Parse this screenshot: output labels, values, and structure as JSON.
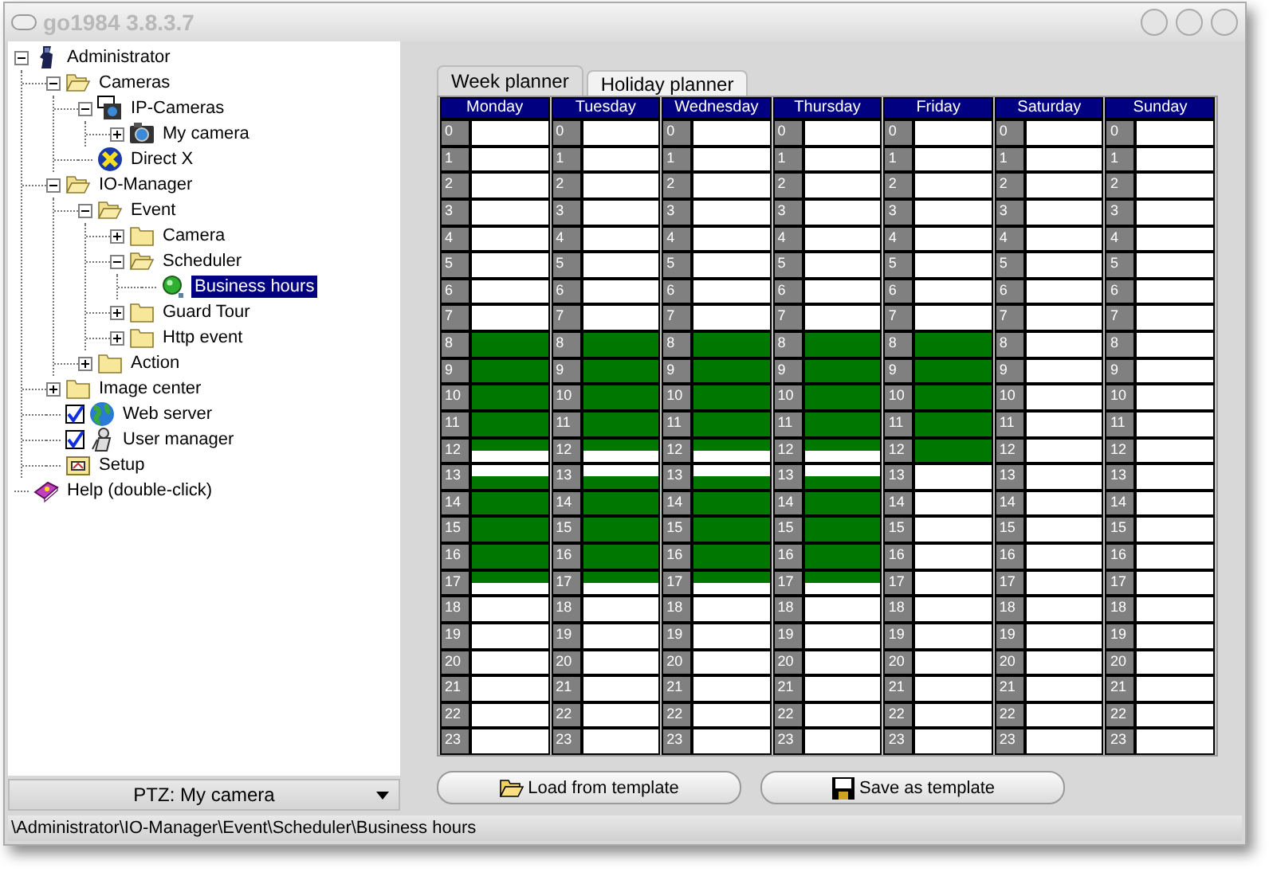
{
  "window": {
    "title": "go1984 3.8.3.7"
  },
  "tree": [
    {
      "label": "Administrator",
      "kind": "user",
      "expanded": true,
      "selected": false,
      "children": [
        {
          "label": "Cameras",
          "kind": "folder",
          "expanded": true,
          "selected": false,
          "children": [
            {
              "label": "IP-Cameras",
              "kind": "camera-group",
              "expanded": true,
              "selected": false,
              "children": [
                {
                  "label": "My camera",
                  "kind": "camera",
                  "expanded": false,
                  "selected": false
                }
              ]
            },
            {
              "label": "Direct X",
              "kind": "directx",
              "selected": false
            }
          ]
        },
        {
          "label": "IO-Manager",
          "kind": "folder",
          "expanded": true,
          "selected": false,
          "children": [
            {
              "label": "Event",
              "kind": "folder",
              "expanded": true,
              "selected": false,
              "children": [
                {
                  "label": "Camera",
                  "kind": "folder",
                  "expanded": false,
                  "selected": false
                },
                {
                  "label": "Scheduler",
                  "kind": "folder",
                  "expanded": true,
                  "selected": false,
                  "children": [
                    {
                      "label": "Business hours",
                      "kind": "schedule",
                      "selected": true
                    }
                  ]
                },
                {
                  "label": "Guard Tour",
                  "kind": "folder",
                  "expanded": false,
                  "selected": false
                },
                {
                  "label": "Http event",
                  "kind": "folder",
                  "expanded": false,
                  "selected": false
                }
              ]
            },
            {
              "label": "Action",
              "kind": "folder",
              "expanded": false,
              "selected": false
            }
          ]
        },
        {
          "label": "Image center",
          "kind": "folder",
          "expanded": false,
          "selected": false
        },
        {
          "label": "Web server",
          "kind": "globe",
          "selected": false,
          "checked": true
        },
        {
          "label": "User manager",
          "kind": "users",
          "selected": false,
          "checked": true
        },
        {
          "label": "Setup",
          "kind": "setup",
          "selected": false
        }
      ]
    },
    {
      "label": "Help (double-click)",
      "kind": "help",
      "selected": false
    }
  ],
  "ptz_selector": {
    "value": "PTZ: My camera"
  },
  "tabs": [
    {
      "label": "Week planner",
      "selected": true
    },
    {
      "label": "Holiday planner",
      "selected": false
    }
  ],
  "days": [
    {
      "name": "Monday",
      "slots": [
        {
          "hour": "0",
          "first_half": false,
          "second_half": false
        },
        {
          "hour": "1",
          "first_half": false,
          "second_half": false
        },
        {
          "hour": "2",
          "first_half": false,
          "second_half": false
        },
        {
          "hour": "3",
          "first_half": false,
          "second_half": false
        },
        {
          "hour": "4",
          "first_half": false,
          "second_half": false
        },
        {
          "hour": "5",
          "first_half": false,
          "second_half": false
        },
        {
          "hour": "6",
          "first_half": false,
          "second_half": false
        },
        {
          "hour": "7",
          "first_half": false,
          "second_half": false
        },
        {
          "hour": "8",
          "first_half": true,
          "second_half": true
        },
        {
          "hour": "9",
          "first_half": true,
          "second_half": true
        },
        {
          "hour": "10",
          "first_half": true,
          "second_half": true
        },
        {
          "hour": "11",
          "first_half": true,
          "second_half": true
        },
        {
          "hour": "12",
          "first_half": true,
          "second_half": false
        },
        {
          "hour": "13",
          "first_half": false,
          "second_half": true
        },
        {
          "hour": "14",
          "first_half": true,
          "second_half": true
        },
        {
          "hour": "15",
          "first_half": true,
          "second_half": true
        },
        {
          "hour": "16",
          "first_half": true,
          "second_half": true
        },
        {
          "hour": "17",
          "first_half": true,
          "second_half": false
        },
        {
          "hour": "18",
          "first_half": false,
          "second_half": false
        },
        {
          "hour": "19",
          "first_half": false,
          "second_half": false
        },
        {
          "hour": "20",
          "first_half": false,
          "second_half": false
        },
        {
          "hour": "21",
          "first_half": false,
          "second_half": false
        },
        {
          "hour": "22",
          "first_half": false,
          "second_half": false
        },
        {
          "hour": "23",
          "first_half": false,
          "second_half": false
        }
      ]
    },
    {
      "name": "Tuesday",
      "slots": [
        {
          "hour": "0",
          "first_half": false,
          "second_half": false
        },
        {
          "hour": "1",
          "first_half": false,
          "second_half": false
        },
        {
          "hour": "2",
          "first_half": false,
          "second_half": false
        },
        {
          "hour": "3",
          "first_half": false,
          "second_half": false
        },
        {
          "hour": "4",
          "first_half": false,
          "second_half": false
        },
        {
          "hour": "5",
          "first_half": false,
          "second_half": false
        },
        {
          "hour": "6",
          "first_half": false,
          "second_half": false
        },
        {
          "hour": "7",
          "first_half": false,
          "second_half": false
        },
        {
          "hour": "8",
          "first_half": true,
          "second_half": true
        },
        {
          "hour": "9",
          "first_half": true,
          "second_half": true
        },
        {
          "hour": "10",
          "first_half": true,
          "second_half": true
        },
        {
          "hour": "11",
          "first_half": true,
          "second_half": true
        },
        {
          "hour": "12",
          "first_half": true,
          "second_half": false
        },
        {
          "hour": "13",
          "first_half": false,
          "second_half": true
        },
        {
          "hour": "14",
          "first_half": true,
          "second_half": true
        },
        {
          "hour": "15",
          "first_half": true,
          "second_half": true
        },
        {
          "hour": "16",
          "first_half": true,
          "second_half": true
        },
        {
          "hour": "17",
          "first_half": true,
          "second_half": false
        },
        {
          "hour": "18",
          "first_half": false,
          "second_half": false
        },
        {
          "hour": "19",
          "first_half": false,
          "second_half": false
        },
        {
          "hour": "20",
          "first_half": false,
          "second_half": false
        },
        {
          "hour": "21",
          "first_half": false,
          "second_half": false
        },
        {
          "hour": "22",
          "first_half": false,
          "second_half": false
        },
        {
          "hour": "23",
          "first_half": false,
          "second_half": false
        }
      ]
    },
    {
      "name": "Wednesday",
      "slots": [
        {
          "hour": "0",
          "first_half": false,
          "second_half": false
        },
        {
          "hour": "1",
          "first_half": false,
          "second_half": false
        },
        {
          "hour": "2",
          "first_half": false,
          "second_half": false
        },
        {
          "hour": "3",
          "first_half": false,
          "second_half": false
        },
        {
          "hour": "4",
          "first_half": false,
          "second_half": false
        },
        {
          "hour": "5",
          "first_half": false,
          "second_half": false
        },
        {
          "hour": "6",
          "first_half": false,
          "second_half": false
        },
        {
          "hour": "7",
          "first_half": false,
          "second_half": false
        },
        {
          "hour": "8",
          "first_half": true,
          "second_half": true
        },
        {
          "hour": "9",
          "first_half": true,
          "second_half": true
        },
        {
          "hour": "10",
          "first_half": true,
          "second_half": true
        },
        {
          "hour": "11",
          "first_half": true,
          "second_half": true
        },
        {
          "hour": "12",
          "first_half": true,
          "second_half": false
        },
        {
          "hour": "13",
          "first_half": false,
          "second_half": true
        },
        {
          "hour": "14",
          "first_half": true,
          "second_half": true
        },
        {
          "hour": "15",
          "first_half": true,
          "second_half": true
        },
        {
          "hour": "16",
          "first_half": true,
          "second_half": true
        },
        {
          "hour": "17",
          "first_half": true,
          "second_half": false
        },
        {
          "hour": "18",
          "first_half": false,
          "second_half": false
        },
        {
          "hour": "19",
          "first_half": false,
          "second_half": false
        },
        {
          "hour": "20",
          "first_half": false,
          "second_half": false
        },
        {
          "hour": "21",
          "first_half": false,
          "second_half": false
        },
        {
          "hour": "22",
          "first_half": false,
          "second_half": false
        },
        {
          "hour": "23",
          "first_half": false,
          "second_half": false
        }
      ]
    },
    {
      "name": "Thursday",
      "slots": [
        {
          "hour": "0",
          "first_half": false,
          "second_half": false
        },
        {
          "hour": "1",
          "first_half": false,
          "second_half": false
        },
        {
          "hour": "2",
          "first_half": false,
          "second_half": false
        },
        {
          "hour": "3",
          "first_half": false,
          "second_half": false
        },
        {
          "hour": "4",
          "first_half": false,
          "second_half": false
        },
        {
          "hour": "5",
          "first_half": false,
          "second_half": false
        },
        {
          "hour": "6",
          "first_half": false,
          "second_half": false
        },
        {
          "hour": "7",
          "first_half": false,
          "second_half": false
        },
        {
          "hour": "8",
          "first_half": true,
          "second_half": true
        },
        {
          "hour": "9",
          "first_half": true,
          "second_half": true
        },
        {
          "hour": "10",
          "first_half": true,
          "second_half": true
        },
        {
          "hour": "11",
          "first_half": true,
          "second_half": true
        },
        {
          "hour": "12",
          "first_half": true,
          "second_half": false
        },
        {
          "hour": "13",
          "first_half": false,
          "second_half": true
        },
        {
          "hour": "14",
          "first_half": true,
          "second_half": true
        },
        {
          "hour": "15",
          "first_half": true,
          "second_half": true
        },
        {
          "hour": "16",
          "first_half": true,
          "second_half": true
        },
        {
          "hour": "17",
          "first_half": true,
          "second_half": false
        },
        {
          "hour": "18",
          "first_half": false,
          "second_half": false
        },
        {
          "hour": "19",
          "first_half": false,
          "second_half": false
        },
        {
          "hour": "20",
          "first_half": false,
          "second_half": false
        },
        {
          "hour": "21",
          "first_half": false,
          "second_half": false
        },
        {
          "hour": "22",
          "first_half": false,
          "second_half": false
        },
        {
          "hour": "23",
          "first_half": false,
          "second_half": false
        }
      ]
    },
    {
      "name": "Friday",
      "slots": [
        {
          "hour": "0",
          "first_half": false,
          "second_half": false
        },
        {
          "hour": "1",
          "first_half": false,
          "second_half": false
        },
        {
          "hour": "2",
          "first_half": false,
          "second_half": false
        },
        {
          "hour": "3",
          "first_half": false,
          "second_half": false
        },
        {
          "hour": "4",
          "first_half": false,
          "second_half": false
        },
        {
          "hour": "5",
          "first_half": false,
          "second_half": false
        },
        {
          "hour": "6",
          "first_half": false,
          "second_half": false
        },
        {
          "hour": "7",
          "first_half": false,
          "second_half": false
        },
        {
          "hour": "8",
          "first_half": true,
          "second_half": true
        },
        {
          "hour": "9",
          "first_half": true,
          "second_half": true
        },
        {
          "hour": "10",
          "first_half": true,
          "second_half": true
        },
        {
          "hour": "11",
          "first_half": true,
          "second_half": true
        },
        {
          "hour": "12",
          "first_half": true,
          "second_half": true
        },
        {
          "hour": "13",
          "first_half": false,
          "second_half": false
        },
        {
          "hour": "14",
          "first_half": false,
          "second_half": false
        },
        {
          "hour": "15",
          "first_half": false,
          "second_half": false
        },
        {
          "hour": "16",
          "first_half": false,
          "second_half": false
        },
        {
          "hour": "17",
          "first_half": false,
          "second_half": false
        },
        {
          "hour": "18",
          "first_half": false,
          "second_half": false
        },
        {
          "hour": "19",
          "first_half": false,
          "second_half": false
        },
        {
          "hour": "20",
          "first_half": false,
          "second_half": false
        },
        {
          "hour": "21",
          "first_half": false,
          "second_half": false
        },
        {
          "hour": "22",
          "first_half": false,
          "second_half": false
        },
        {
          "hour": "23",
          "first_half": false,
          "second_half": false
        }
      ]
    },
    {
      "name": "Saturday",
      "slots": [
        {
          "hour": "0",
          "first_half": false,
          "second_half": false
        },
        {
          "hour": "1",
          "first_half": false,
          "second_half": false
        },
        {
          "hour": "2",
          "first_half": false,
          "second_half": false
        },
        {
          "hour": "3",
          "first_half": false,
          "second_half": false
        },
        {
          "hour": "4",
          "first_half": false,
          "second_half": false
        },
        {
          "hour": "5",
          "first_half": false,
          "second_half": false
        },
        {
          "hour": "6",
          "first_half": false,
          "second_half": false
        },
        {
          "hour": "7",
          "first_half": false,
          "second_half": false
        },
        {
          "hour": "8",
          "first_half": false,
          "second_half": false
        },
        {
          "hour": "9",
          "first_half": false,
          "second_half": false
        },
        {
          "hour": "10",
          "first_half": false,
          "second_half": false
        },
        {
          "hour": "11",
          "first_half": false,
          "second_half": false
        },
        {
          "hour": "12",
          "first_half": false,
          "second_half": false
        },
        {
          "hour": "13",
          "first_half": false,
          "second_half": false
        },
        {
          "hour": "14",
          "first_half": false,
          "second_half": false
        },
        {
          "hour": "15",
          "first_half": false,
          "second_half": false
        },
        {
          "hour": "16",
          "first_half": false,
          "second_half": false
        },
        {
          "hour": "17",
          "first_half": false,
          "second_half": false
        },
        {
          "hour": "18",
          "first_half": false,
          "second_half": false
        },
        {
          "hour": "19",
          "first_half": false,
          "second_half": false
        },
        {
          "hour": "20",
          "first_half": false,
          "second_half": false
        },
        {
          "hour": "21",
          "first_half": false,
          "second_half": false
        },
        {
          "hour": "22",
          "first_half": false,
          "second_half": false
        },
        {
          "hour": "23",
          "first_half": false,
          "second_half": false
        }
      ]
    },
    {
      "name": "Sunday",
      "slots": [
        {
          "hour": "0",
          "first_half": false,
          "second_half": false
        },
        {
          "hour": "1",
          "first_half": false,
          "second_half": false
        },
        {
          "hour": "2",
          "first_half": false,
          "second_half": false
        },
        {
          "hour": "3",
          "first_half": false,
          "second_half": false
        },
        {
          "hour": "4",
          "first_half": false,
          "second_half": false
        },
        {
          "hour": "5",
          "first_half": false,
          "second_half": false
        },
        {
          "hour": "6",
          "first_half": false,
          "second_half": false
        },
        {
          "hour": "7",
          "first_half": false,
          "second_half": false
        },
        {
          "hour": "8",
          "first_half": false,
          "second_half": false
        },
        {
          "hour": "9",
          "first_half": false,
          "second_half": false
        },
        {
          "hour": "10",
          "first_half": false,
          "second_half": false
        },
        {
          "hour": "11",
          "first_half": false,
          "second_half": false
        },
        {
          "hour": "12",
          "first_half": false,
          "second_half": false
        },
        {
          "hour": "13",
          "first_half": false,
          "second_half": false
        },
        {
          "hour": "14",
          "first_half": false,
          "second_half": false
        },
        {
          "hour": "15",
          "first_half": false,
          "second_half": false
        },
        {
          "hour": "16",
          "first_half": false,
          "second_half": false
        },
        {
          "hour": "17",
          "first_half": false,
          "second_half": false
        },
        {
          "hour": "18",
          "first_half": false,
          "second_half": false
        },
        {
          "hour": "19",
          "first_half": false,
          "second_half": false
        },
        {
          "hour": "20",
          "first_half": false,
          "second_half": false
        },
        {
          "hour": "21",
          "first_half": false,
          "second_half": false
        },
        {
          "hour": "22",
          "first_half": false,
          "second_half": false
        },
        {
          "hour": "23",
          "first_half": false,
          "second_half": false
        }
      ]
    }
  ],
  "buttons": [
    {
      "label": "Load from template",
      "kind": "load"
    },
    {
      "label": "Save as template",
      "kind": "save"
    }
  ],
  "status_bar": {
    "path": "\\Administrator\\IO-Manager\\Event\\Scheduler\\Business hours"
  }
}
